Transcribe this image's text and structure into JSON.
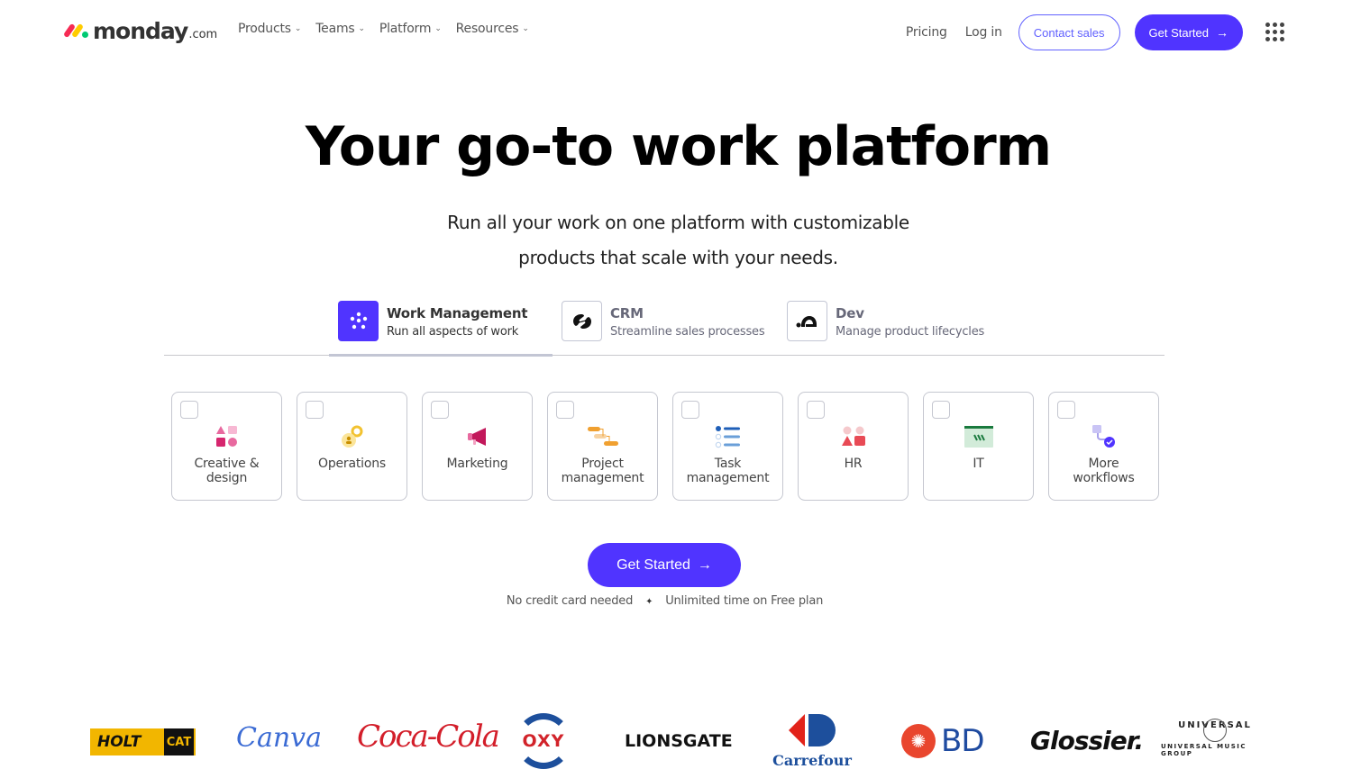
{
  "header": {
    "logo": {
      "word": "monday",
      "suffix": ".com"
    },
    "nav": [
      {
        "label": "Products",
        "icon": "chevron-down"
      },
      {
        "label": "Teams",
        "icon": "chevron-down"
      },
      {
        "label": "Platform",
        "icon": "chevron-down"
      },
      {
        "label": "Resources",
        "icon": "chevron-down"
      }
    ],
    "pricing": "Pricing",
    "login": "Log in",
    "contact_sales": "Contact sales",
    "get_started": "Get Started",
    "arrow": "→",
    "apps_icon": "grid-dots-icon"
  },
  "hero": {
    "title": "Your go-to work platform",
    "subtitle_line1": "Run all your work on one platform with customizable",
    "subtitle_line2": "products that scale with your needs."
  },
  "products": [
    {
      "name": "Work Management",
      "desc": "Run all aspects of work",
      "active": true,
      "icon": "work-management-icon",
      "color": "#5034ff"
    },
    {
      "name": "CRM",
      "desc": "Streamline sales processes",
      "active": false,
      "icon": "crm-icon"
    },
    {
      "name": "Dev",
      "desc": "Manage product lifecycles",
      "active": false,
      "icon": "dev-icon"
    }
  ],
  "workflows": [
    {
      "label_line1": "Creative &",
      "label_line2": "design",
      "icon": "shapes-icon",
      "checked": false
    },
    {
      "label_line1": "Operations",
      "label_line2": "",
      "icon": "gears-icon",
      "checked": false
    },
    {
      "label_line1": "Marketing",
      "label_line2": "",
      "icon": "megaphone-icon",
      "checked": false
    },
    {
      "label_line1": "Project",
      "label_line2": "management",
      "icon": "gantt-icon",
      "checked": false
    },
    {
      "label_line1": "Task",
      "label_line2": "management",
      "icon": "checklist-icon",
      "checked": false
    },
    {
      "label_line1": "HR",
      "label_line2": "",
      "icon": "people-icon",
      "checked": false
    },
    {
      "label_line1": "IT",
      "label_line2": "",
      "icon": "window-icon",
      "checked": false
    },
    {
      "label_line1": "More",
      "label_line2": "workflows",
      "icon": "workflow-icon",
      "checked": false
    }
  ],
  "cta": {
    "label": "Get Started",
    "arrow": "→",
    "note_left": "No credit card needed",
    "separator": "✦",
    "note_right": "Unlimited time on Free plan"
  },
  "brands": {
    "holt": "HOLT",
    "cat": "CAT",
    "canva": "Canva",
    "cocacola": "Coca-Cola",
    "oxy": "OXY",
    "lionsgate": "LIONSGATE",
    "carrefour": "Carrefour",
    "bd": "BD",
    "glossier": "Glossier.",
    "universal": "UNIVERSAL",
    "universal_sub": "UNIVERSAL MUSIC GROUP"
  }
}
